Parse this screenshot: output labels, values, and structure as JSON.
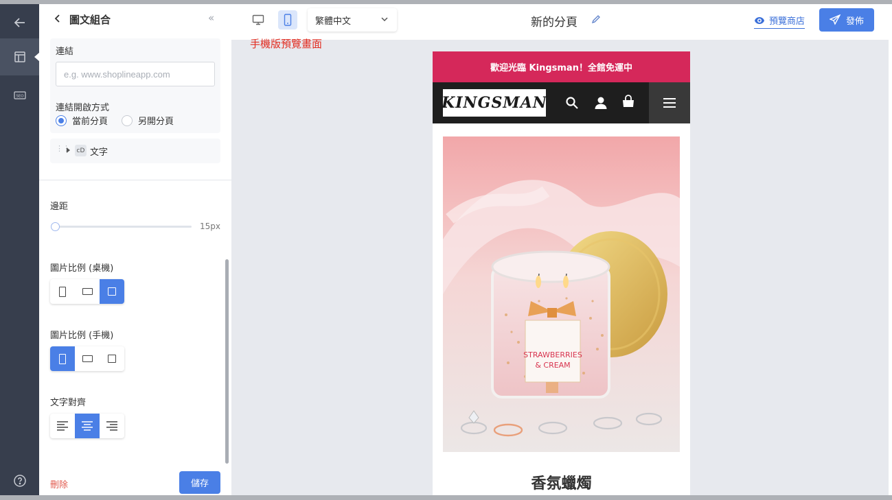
{
  "panel": {
    "title": "圖文組合",
    "link_label": "連結",
    "link_placeholder": "e.g. www.shoplineapp.com",
    "link_value": "",
    "open_mode_label": "連結開啟方式",
    "open_mode_options": [
      "當前分頁",
      "另開分頁"
    ],
    "open_mode_selected": "當前分頁",
    "text_block_label": "文字",
    "padding_label": "邊距",
    "padding_value": "15px",
    "ratio_desktop_label": "圖片比例 (桌機)",
    "ratio_mobile_label": "圖片比例 (手機)",
    "align_label": "文字對齊",
    "delete_label": "刪除",
    "save_label": "儲存"
  },
  "toolbar": {
    "language": "繁體中文",
    "page_name": "新的分頁",
    "preview_label": "預覽商店",
    "publish_label": "發佈"
  },
  "preview_caption": "手機版預覽畫面",
  "phone": {
    "announcement": "歡迎光臨 Kingsman！全館免運中",
    "logo": "KINGSMAN",
    "product_title": "香氛蠟燭",
    "candle_label_line1": "STRAWBERRIES",
    "candle_label_line2": "& CREAM"
  },
  "colors": {
    "accent": "#4a7fe6",
    "rail": "#373e4d",
    "announcement": "#d5285a",
    "danger": "#e15a4e",
    "caption": "#e22b1f"
  },
  "icons": [
    "back-arrow-icon",
    "layout-icon",
    "seo-icon",
    "help-icon",
    "desktop-icon",
    "mobile-icon",
    "pencil-icon",
    "eye-icon",
    "send-icon",
    "search-icon",
    "user-icon",
    "bag-icon",
    "hamburger-icon"
  ]
}
